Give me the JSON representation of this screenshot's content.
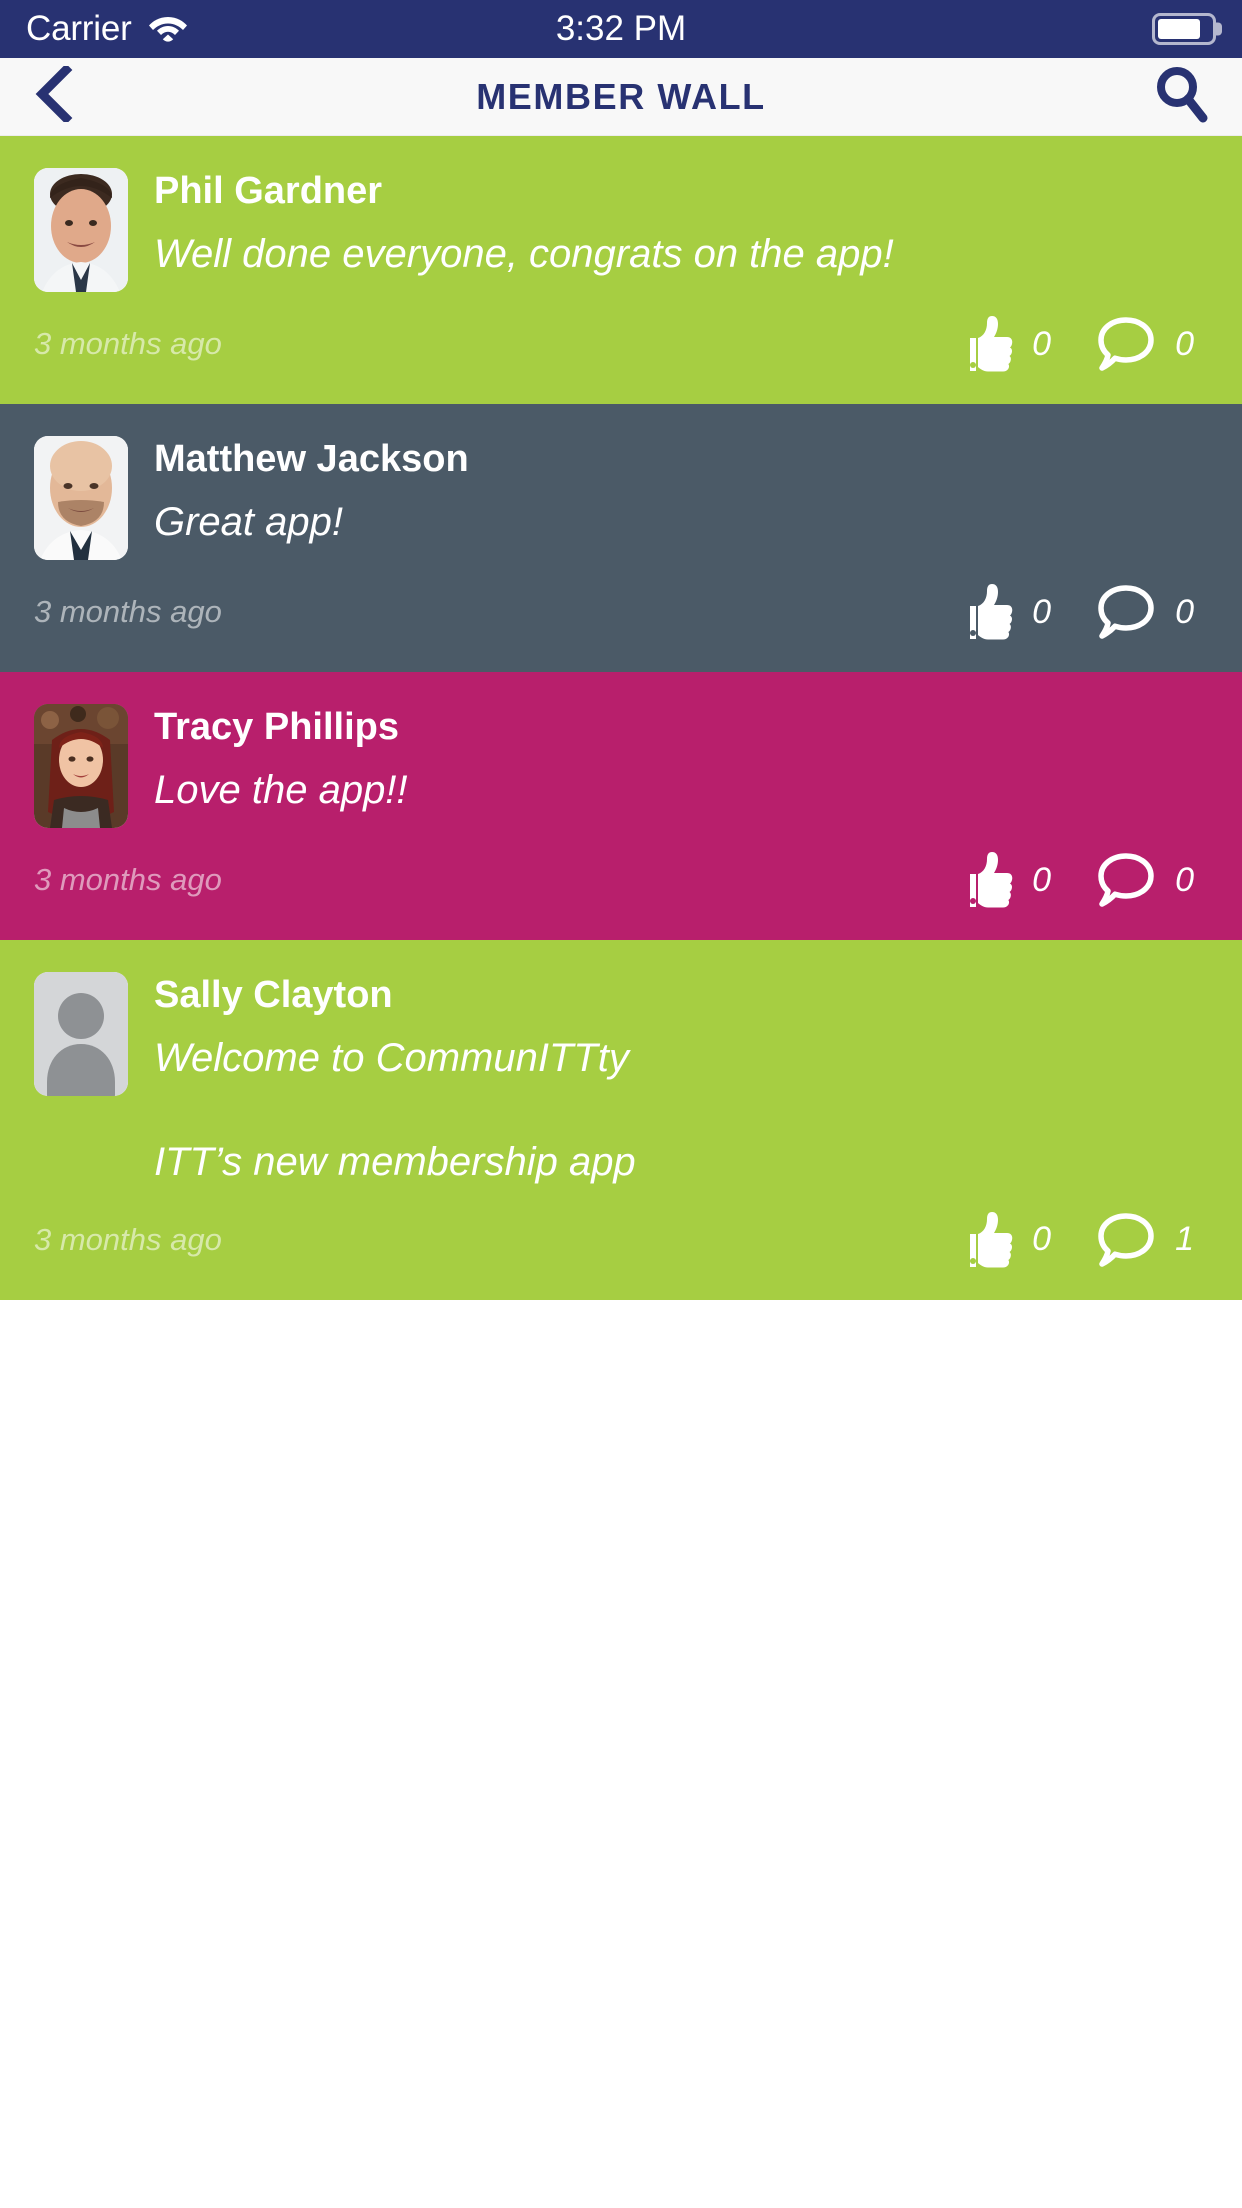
{
  "status_bar": {
    "carrier": "Carrier",
    "time": "3:32 PM",
    "wifi_icon": "wifi-icon",
    "battery_icon": "battery-icon",
    "battery_level_pct": 80,
    "background_color": "#283272"
  },
  "nav_bar": {
    "back_icon": "chevron-left-icon",
    "title": "MEMBER WALL",
    "search_icon": "search-icon",
    "background_color": "#f8f8f8",
    "title_color": "#283272"
  },
  "theme": {
    "green": "#a6ce42",
    "slate": "#4b5a67",
    "magenta": "#b81f6c",
    "navy": "#283272",
    "white": "#ffffff"
  },
  "feed": {
    "posts": [
      {
        "author": "Phil Gardner",
        "message": "Well done everyone, congrats on the app!",
        "timestamp": "3 months ago",
        "likes": "0",
        "comments": "0",
        "background_color": "#a6ce42",
        "avatar_type": "photo-male-dark-hair"
      },
      {
        "author": "Matthew Jackson",
        "message": "Great app!",
        "timestamp": "3 months ago",
        "likes": "0",
        "comments": "0",
        "background_color": "#4b5a67",
        "avatar_type": "photo-male-bald-beard"
      },
      {
        "author": "Tracy Phillips",
        "message": "Love the app!!",
        "timestamp": "3 months ago",
        "likes": "0",
        "comments": "0",
        "background_color": "#b81f6c",
        "avatar_type": "photo-female-red-hair"
      },
      {
        "author": "Sally Clayton",
        "message": "Welcome to CommunITTty\n\nITT’s new membership app",
        "timestamp": "3 months ago",
        "likes": "0",
        "comments": "1",
        "background_color": "#a6ce42",
        "avatar_type": "placeholder-silhouette"
      }
    ]
  }
}
